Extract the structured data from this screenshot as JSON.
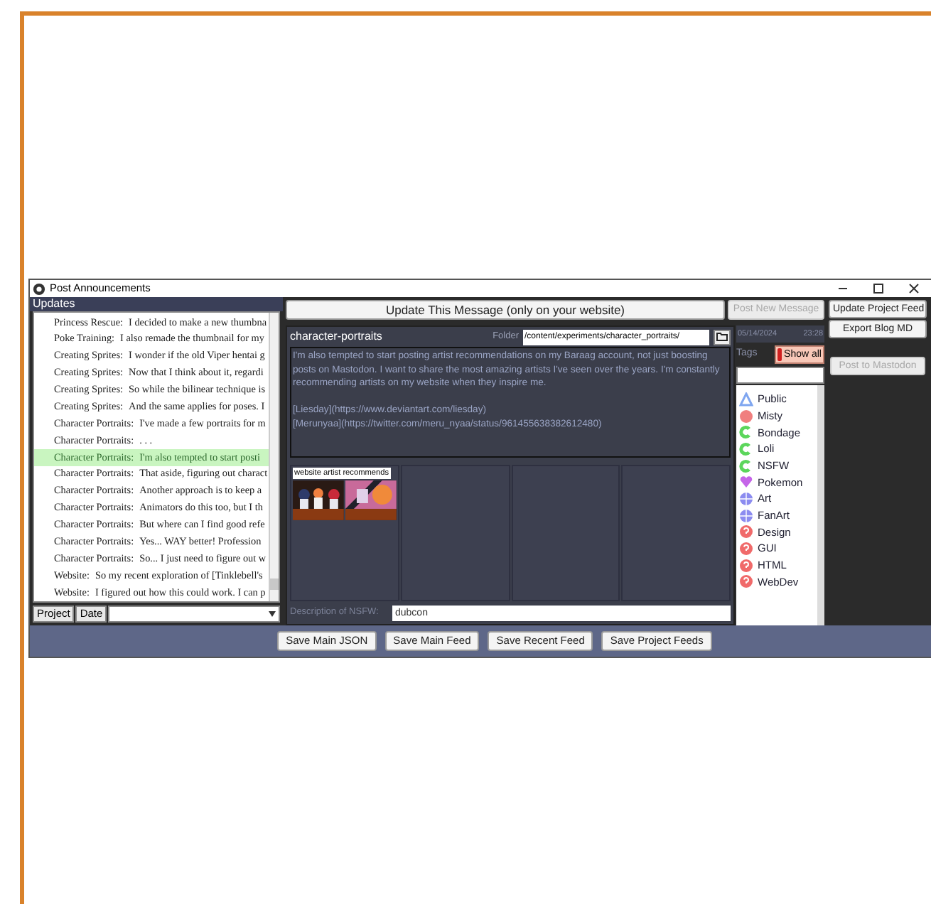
{
  "window": {
    "title": "Post Announcements"
  },
  "updates": {
    "header": "Updates",
    "rows": [
      {
        "project": "Princess Rescue:",
        "text": "I decided to make a new thumbna",
        "selected": false
      },
      {
        "project": "Poke Training:",
        "text": "I also remade the thumbnail for my",
        "selected": false
      },
      {
        "project": "Creating Sprites:",
        "text": "I wonder if the old Viper hentai g",
        "selected": false
      },
      {
        "project": "Creating Sprites:",
        "text": "Now that I think about it, regardi",
        "selected": false
      },
      {
        "project": "Creating Sprites:",
        "text": "So while the bilinear technique is",
        "selected": false
      },
      {
        "project": "Creating Sprites:",
        "text": "And the same applies for poses. I",
        "selected": false
      },
      {
        "project": "Character Portraits:",
        "text": "I've made a few portraits for m",
        "selected": false
      },
      {
        "project": "Character Portraits:",
        "text": ". . .",
        "selected": false
      },
      {
        "project": "Character Portraits:",
        "text": "I'm also tempted to start posti",
        "selected": true
      },
      {
        "project": "Character Portraits:",
        "text": "That aside, figuring out charact",
        "selected": false
      },
      {
        "project": "Character Portraits:",
        "text": "Another approach is to keep a",
        "selected": false
      },
      {
        "project": "Character Portraits:",
        "text": "Animators do this too, but I th",
        "selected": false
      },
      {
        "project": "Character Portraits:",
        "text": "But where can I find good refe",
        "selected": false
      },
      {
        "project": "Character Portraits:",
        "text": "Yes... WAY better! Profession",
        "selected": false
      },
      {
        "project": "Character Portraits:",
        "text": "So... I just need to figure out w",
        "selected": false
      },
      {
        "project": "Website:",
        "text": "So my recent exploration of [Tinklebell's",
        "selected": false
      },
      {
        "project": "Website:",
        "text": "I figured out how this could work. I can p",
        "selected": false
      }
    ],
    "sort_buttons": [
      "Project",
      "Date"
    ]
  },
  "top_buttons": [
    {
      "label": "Update This Message  (only on your website)",
      "disabled": false
    },
    {
      "label": "Post New Message",
      "disabled": true
    }
  ],
  "side_buttons": [
    {
      "label": "Update Project Feed",
      "disabled": false
    },
    {
      "label": "Export Blog MD",
      "disabled": false
    },
    {
      "label": "Post to Mastodon",
      "disabled": true
    }
  ],
  "editor": {
    "project": "character-portraits",
    "folder_label": "Folder",
    "folder": "/content/experiments/character_portraits/",
    "body": [
      [
        "I'm also tempted to start posting artist recommendations on my Baraag account, not just boosting posts on Mastodon. I want to share the most amazing artists I've seen over the years. I'm constantly recommending artists on my website when they inspire me."
      ],
      [
        "[Liesday](https://www.deviantart.com/liesday)",
        "[Merunyaa](https://twitter.com/meru_nyaa/status/961455638382612480)"
      ]
    ],
    "gallery": [
      {
        "kind": "filled",
        "caption": "website artist recommends"
      },
      {
        "kind": "empty"
      },
      {
        "kind": "empty"
      },
      {
        "kind": "empty"
      }
    ],
    "nsfw_label": "Description of NSFW:",
    "nsfw": "dubcon"
  },
  "meta": {
    "date": "05/14/2024",
    "time": "23:28",
    "tags_label": "Tags",
    "show_all": {
      "label": "Show all",
      "on": true
    }
  },
  "tags": [
    {
      "label": "Public",
      "kind": "triangle",
      "color": "#7fa6f0"
    },
    {
      "label": "Misty",
      "kind": "circle",
      "color": "#f07f7f"
    },
    {
      "label": "Bondage",
      "kind": "crescent",
      "color": "#5cd65c"
    },
    {
      "label": "Loli",
      "kind": "crescent",
      "color": "#5cd65c"
    },
    {
      "label": "NSFW",
      "kind": "crescent",
      "color": "#5cd65c"
    },
    {
      "label": "Pokemon",
      "kind": "heart",
      "color": "#c565e8"
    },
    {
      "label": "Art",
      "kind": "globe",
      "color": "#8c8cf0"
    },
    {
      "label": "FanArt",
      "kind": "globe",
      "color": "#8c8cf0"
    },
    {
      "label": "Design",
      "kind": "question",
      "color": "#f06a6a"
    },
    {
      "label": "GUI",
      "kind": "question",
      "color": "#f06a6a"
    },
    {
      "label": "HTML",
      "kind": "question",
      "color": "#f06a6a"
    },
    {
      "label": "WebDev",
      "kind": "question",
      "color": "#f06a6a"
    }
  ],
  "save_buttons": [
    "Save Main JSON",
    "Save Main Feed",
    "Save Recent Feed",
    "Save Project Feeds"
  ]
}
